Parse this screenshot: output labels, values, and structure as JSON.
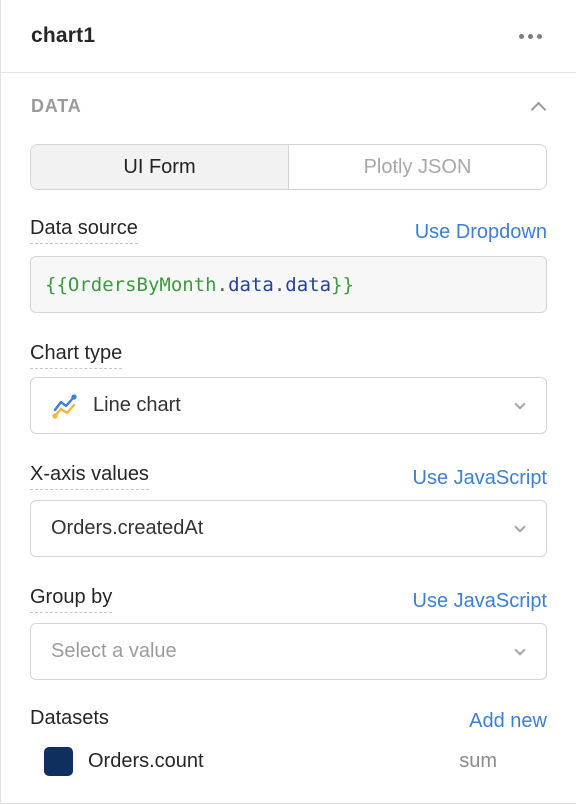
{
  "header": {
    "title": "chart1",
    "more_icon": "ellipsis-icon"
  },
  "section": {
    "label": "DATA",
    "collapse_icon": "chevron-up-icon"
  },
  "mode_tabs": [
    {
      "label": "UI Form",
      "active": true
    },
    {
      "label": "Plotly JSON",
      "active": false
    }
  ],
  "data_source": {
    "label": "Data source",
    "action": "Use Dropdown",
    "value": "{{OrdersByMonth.data.data}}",
    "tokens": {
      "open": "{{",
      "ident": "OrdersByMonth",
      "dot1": ".",
      "prop1": "data",
      "dot2": ".",
      "prop2": "data",
      "close": "}}"
    }
  },
  "chart_type": {
    "label": "Chart type",
    "value": "Line chart",
    "icon": "line-chart-icon"
  },
  "x_axis": {
    "label": "X-axis values",
    "action": "Use JavaScript",
    "value": "Orders.createdAt"
  },
  "group_by": {
    "label": "Group by",
    "action": "Use JavaScript",
    "placeholder": "Select a value"
  },
  "datasets": {
    "label": "Datasets",
    "action": "Add new",
    "items": [
      {
        "name": "Orders.count",
        "aggregation": "sum",
        "color": "#0f2f5e"
      }
    ]
  },
  "colors": {
    "link": "#3c7fd3",
    "code_green": "#3e9a3e",
    "code_blue": "#24429b"
  }
}
